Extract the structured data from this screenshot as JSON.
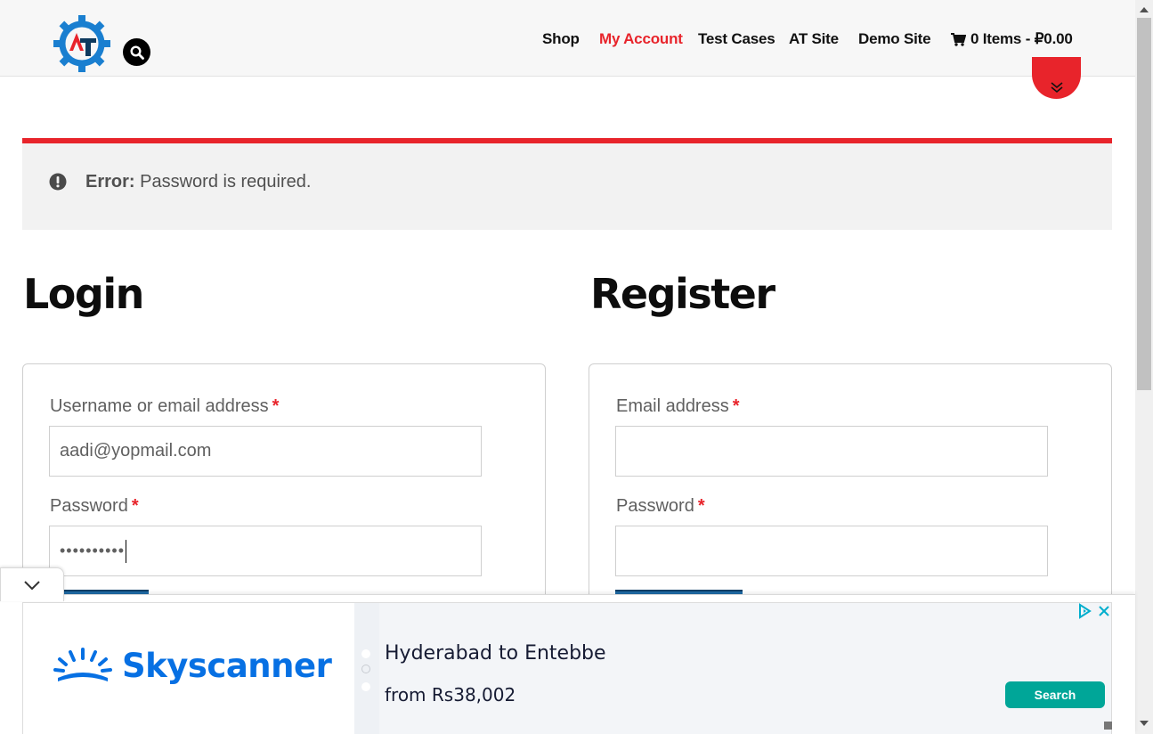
{
  "header": {
    "logo_letters": "AT",
    "nav": [
      {
        "label": "Shop",
        "active": false
      },
      {
        "label": "My Account",
        "active": true
      },
      {
        "label": "Test Cases",
        "active": false
      },
      {
        "label": "AT Site",
        "active": false
      },
      {
        "label": "Demo Site",
        "active": false
      }
    ],
    "cart_label": "0 Items - ₽0.00",
    "icons": {
      "search": "search-icon",
      "cart": "shopping-cart-icon",
      "scroll": "double-chevron-down-icon"
    }
  },
  "notice": {
    "icon": "exclamation-circle-icon",
    "label": "Error:",
    "message": "Password is required.",
    "accent_color": "#e8242b"
  },
  "login": {
    "heading": "Login",
    "username_label": "Username or email address",
    "username_value": "aadi@yopmail.com",
    "password_label": "Password",
    "password_value": "••••••••••",
    "required_mark": "*"
  },
  "register": {
    "heading": "Register",
    "email_label": "Email address",
    "email_value": "",
    "password_label": "Password",
    "password_value": "",
    "required_mark": "*"
  },
  "ad": {
    "collapse_icon": "chevron-down-icon",
    "brand": "Skyscanner",
    "title": "Hyderabad to Entebbe",
    "subtitle": "from Rs38,002",
    "cta": "Search",
    "cta_color": "#00a698",
    "brand_color": "#0770e3"
  }
}
